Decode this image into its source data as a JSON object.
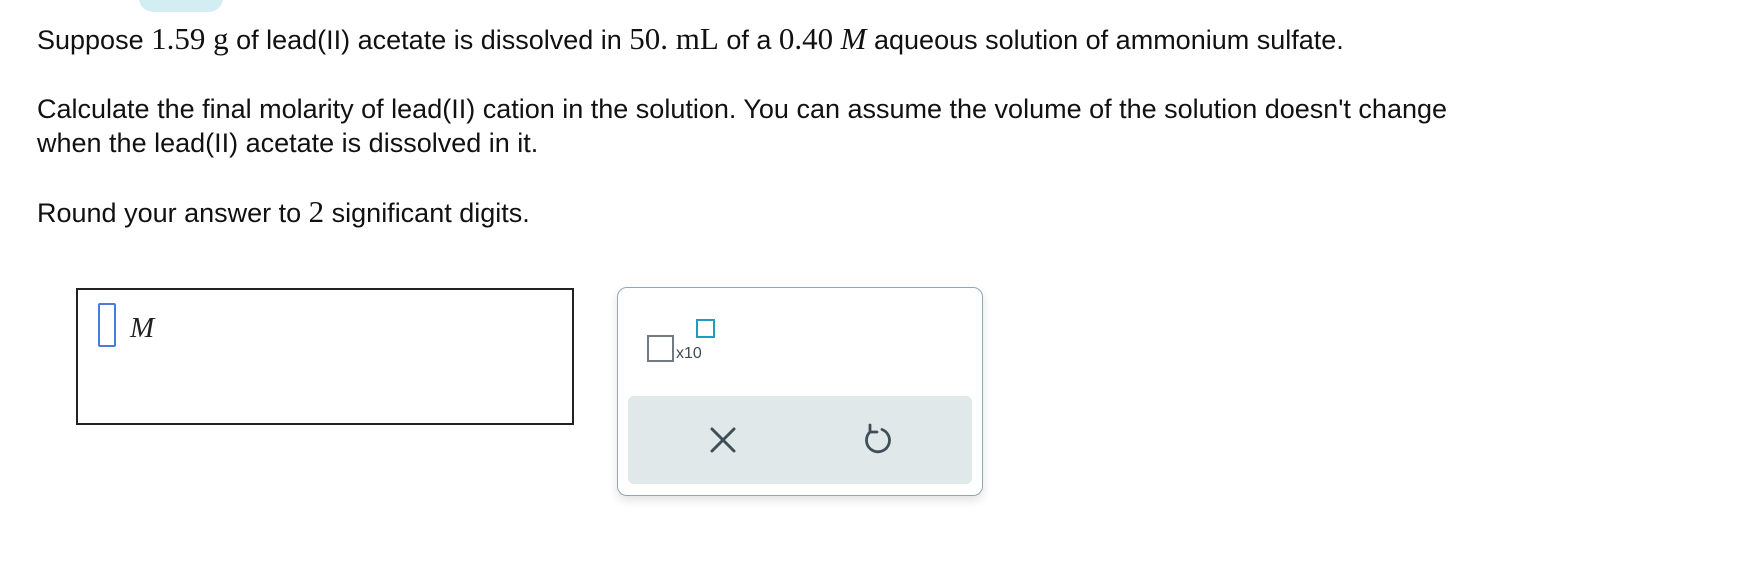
{
  "header": {
    "tab_color": "#d3eef3"
  },
  "problem": {
    "line1": {
      "t1": "Suppose ",
      "mass": "1.59",
      "mass_unit": " g",
      "t2": " of lead(II) acetate is dissolved in ",
      "volume": "50.",
      "volume_unit": " mL",
      "t3": " of a ",
      "conc": "0.40",
      "conc_unit": "M",
      "t4": " aqueous solution of ammonium sulfate."
    },
    "line2": "Calculate the final molarity of lead(II) cation in the solution. You can assume the volume of the solution doesn't change",
    "line3": "when the lead(II) acetate is dissolved in it.",
    "line4": {
      "t1": "Round your answer to ",
      "digits": "2",
      "t2": " significant digits."
    }
  },
  "answer": {
    "value": "",
    "unit": "M",
    "cursor_color": "#4a7bd8"
  },
  "toolbar": {
    "sci_notation_label": "x10",
    "sci_icon": "scientific-notation-icon",
    "clear_icon": "close-icon",
    "undo_icon": "undo-icon",
    "accent_color": "#1f9cc4"
  }
}
